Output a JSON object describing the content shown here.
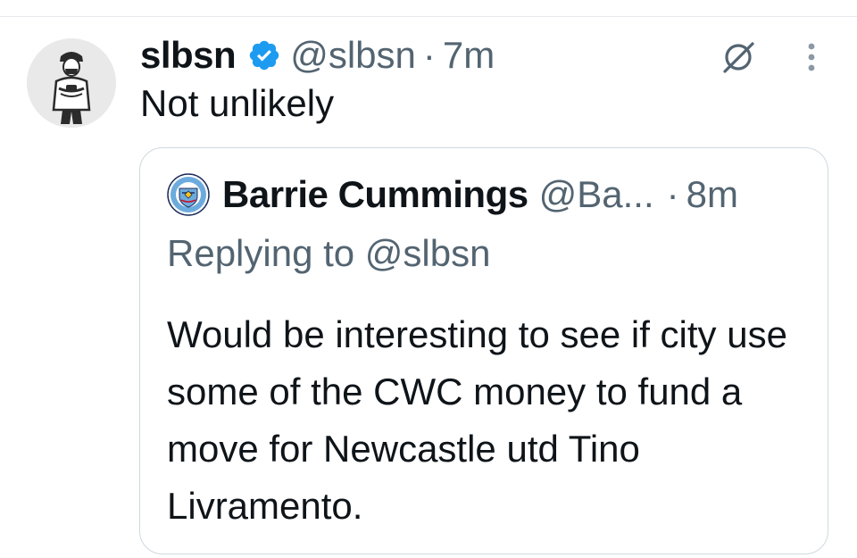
{
  "tweet": {
    "author": {
      "display_name": "slbsn",
      "handle": "@slbsn",
      "verified": true
    },
    "separator": "·",
    "time": "7m",
    "text": "Not unlikely"
  },
  "quoted_tweet": {
    "author": {
      "display_name": "Barrie Cummings",
      "handle": "@Ba..."
    },
    "separator": "·",
    "time": "8m",
    "replying_prefix": "Replying to",
    "replying_to": "@slbsn",
    "text": "Would be interesting to see if city use some of the CWC money to fund a move for Newcastle utd Tino Livramento."
  },
  "icons": {
    "verified": "verified-badge-icon",
    "grok": "grok-icon",
    "more": "more-vertical-icon"
  },
  "colors": {
    "verified_blue": "#1d9bf0",
    "text_primary": "#0f1419",
    "text_secondary": "#536471",
    "border": "#cfd9de",
    "city_blue": "#6cabdd"
  }
}
